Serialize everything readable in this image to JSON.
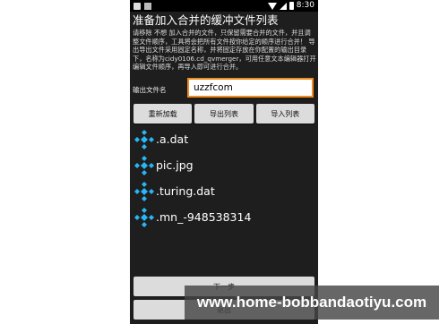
{
  "statusbar": {
    "left_icons": [
      "document-icon",
      "image-icon"
    ],
    "time": "8:30",
    "right_icons": [
      "wifi-icon",
      "signal-icon",
      "battery-icon"
    ]
  },
  "title": "准备加入合并的缓冲文件列表",
  "description": "请移除 不想 加入合并的文件，只保留需要合并的文件，并且调整文件顺序，工具将会把所有文件按你给定的顺序进行合并！ 导出导出文件采用固定名称，并将固定存放在你配置的输出目录下，名称为cidy0106.cd_qvmerger，可用任意文本编辑器打开编辑文件顺序，再导入即可进行合并。",
  "output": {
    "label": "输出文件名",
    "value": "uzzfcom"
  },
  "buttons": {
    "reload": "重新加载",
    "export": "导出列表",
    "import": "导入列表"
  },
  "files": [
    {
      "name": ".a.dat",
      "icon": "file-diamond-icon"
    },
    {
      "name": "pic.jpg",
      "icon": "file-diamond-icon"
    },
    {
      "name": ".turing.dat",
      "icon": "file-diamond-icon"
    },
    {
      "name": ".mn_-948538314",
      "icon": "file-diamond-icon"
    }
  ],
  "bottom": {
    "next": "下一步",
    "exit": "退出"
  },
  "watermark": "www.home-bobbandaotiyu.com",
  "colors": {
    "background": "#1e1e1e",
    "input_border": "#f08c1e",
    "file_icon": "#29b6f6",
    "button": "#dcdcdc"
  }
}
